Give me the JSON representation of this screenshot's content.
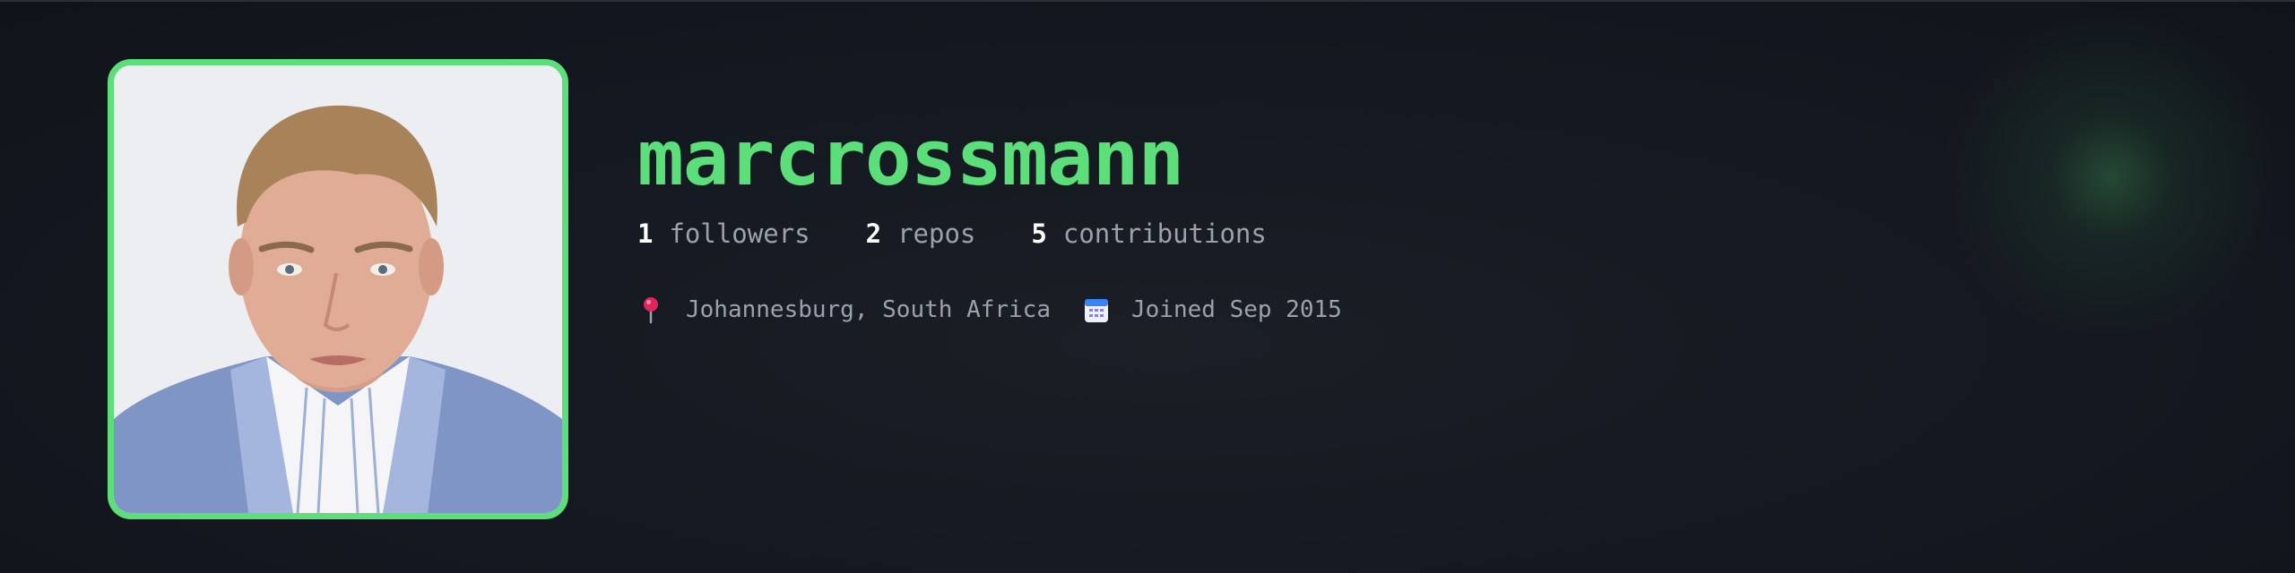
{
  "profile": {
    "username": "marcrossmann",
    "avatar_alt": "Profile photo of marcrossmann"
  },
  "stats": [
    {
      "value": "1",
      "label": "followers"
    },
    {
      "value": "2",
      "label": "repos"
    },
    {
      "value": "5",
      "label": "contributions"
    }
  ],
  "meta": {
    "location": {
      "icon": "map-pin-icon",
      "text": "Johannesburg, South Africa"
    },
    "joined": {
      "icon": "calendar-icon",
      "text": "Joined Sep 2015"
    }
  },
  "colors": {
    "accent": "#5cde7a",
    "background": "#14181f",
    "muted_text": "#9aa2ad",
    "number_text": "#ffffff"
  }
}
